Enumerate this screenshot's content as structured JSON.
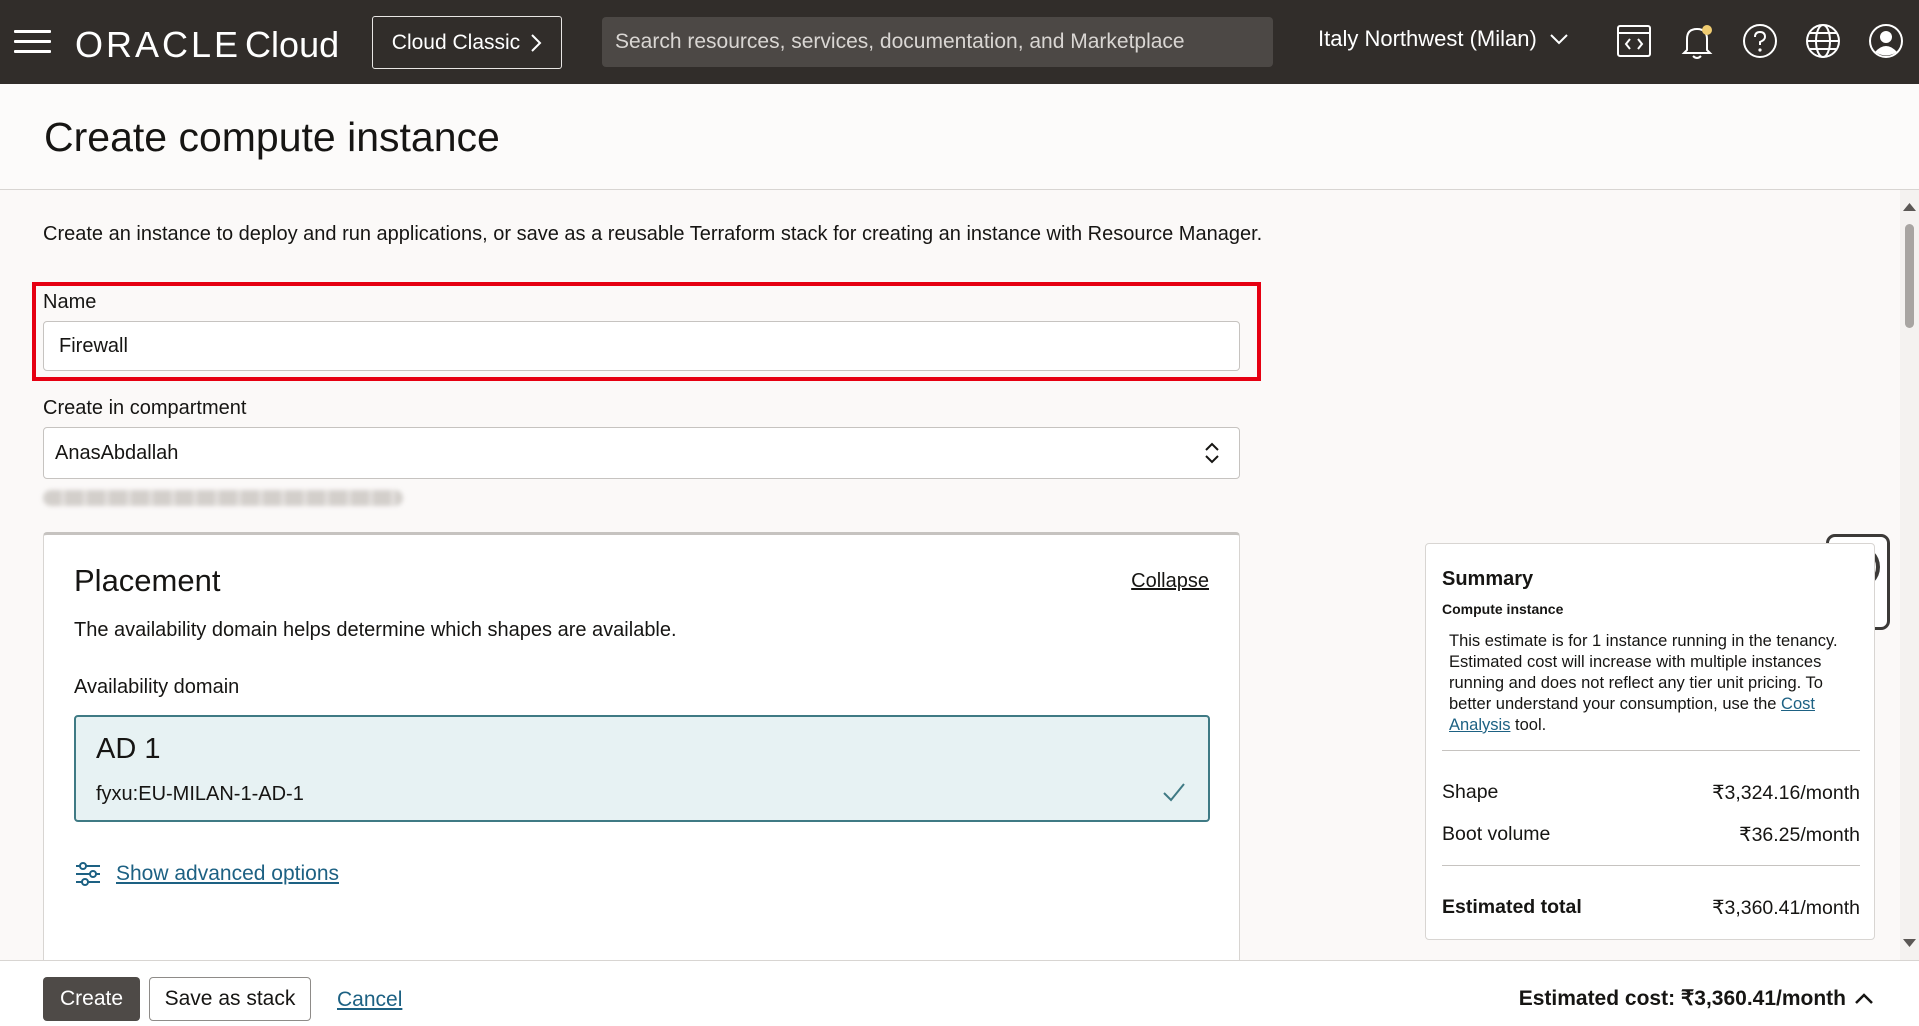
{
  "topbar": {
    "logo_oracle": "ORACLE",
    "logo_cloud": "Cloud",
    "classic_label": "Cloud Classic",
    "search_placeholder": "Search resources, services, documentation, and Marketplace",
    "region": "Italy Northwest (Milan)",
    "icons": [
      "menu-icon",
      "code-editor-icon",
      "bell-icon",
      "help-icon",
      "globe-icon",
      "profile-icon"
    ],
    "bg_color": "#312d2a"
  },
  "page": {
    "title": "Create compute instance",
    "intro": "Create an instance to deploy and run applications, or save as a reusable Terraform stack for creating an instance with Resource Manager."
  },
  "form": {
    "name_label": "Name",
    "name_value": "Firewall",
    "compartment_label": "Create in compartment",
    "compartment_value": "AnasAbdallah",
    "highlight_color": "#e60012"
  },
  "placement": {
    "title": "Placement",
    "collapse_label": "Collapse",
    "description": "The availability domain helps determine which shapes are available.",
    "ad_label": "Availability domain",
    "ad_name": "AD 1",
    "ad_id": "fyxu:EU-MILAN-1-AD-1",
    "advanced_label": "Show advanced options"
  },
  "summary": {
    "title": "Summary",
    "subtitle": "Compute instance",
    "note_before": "This estimate is for 1 instance running in the tenancy. Estimated cost will increase with multiple instances running and does not reflect any tier unit pricing. To better understand your consumption, use the ",
    "note_link": "Cost Analysis",
    "note_after": " tool.",
    "shape_label": "Shape",
    "shape_value": "₹3,324.16/month",
    "boot_label": "Boot volume",
    "boot_value": "₹36.25/month",
    "total_label": "Estimated total",
    "total_value": "₹3,360.41/month"
  },
  "footer": {
    "create_label": "Create",
    "stack_label": "Save as stack",
    "cancel_label": "Cancel",
    "estimated_cost": "Estimated cost: ₹3,360.41/month"
  }
}
